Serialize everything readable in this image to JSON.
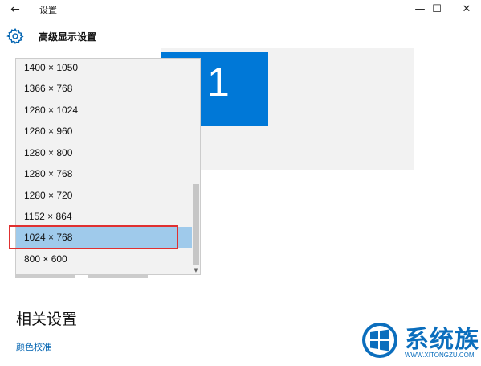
{
  "window": {
    "title": "设置",
    "back_icon": "arrow-left-icon",
    "minimize": "—",
    "maximize": "☐",
    "close": "✕"
  },
  "header": {
    "title": "高级显示设置",
    "icon": "gear-icon"
  },
  "preview": {
    "monitor_number": "1",
    "monitor_color": "#0078d7"
  },
  "resolution_dropdown": {
    "options": [
      "1400 × 1050",
      "1366 × 768",
      "1280 × 1024",
      "1280 × 960",
      "1280 × 800",
      "1280 × 768",
      "1280 × 720",
      "1152 × 864",
      "1024 × 768",
      "800 × 600"
    ],
    "selected": "1024 × 768",
    "highlight_color": "#e03030"
  },
  "related": {
    "title": "相关设置",
    "link_color_calibration": "颜色校准"
  },
  "watermark": {
    "brand": "系统族",
    "url": "WWW.XITONGZU.COM"
  }
}
